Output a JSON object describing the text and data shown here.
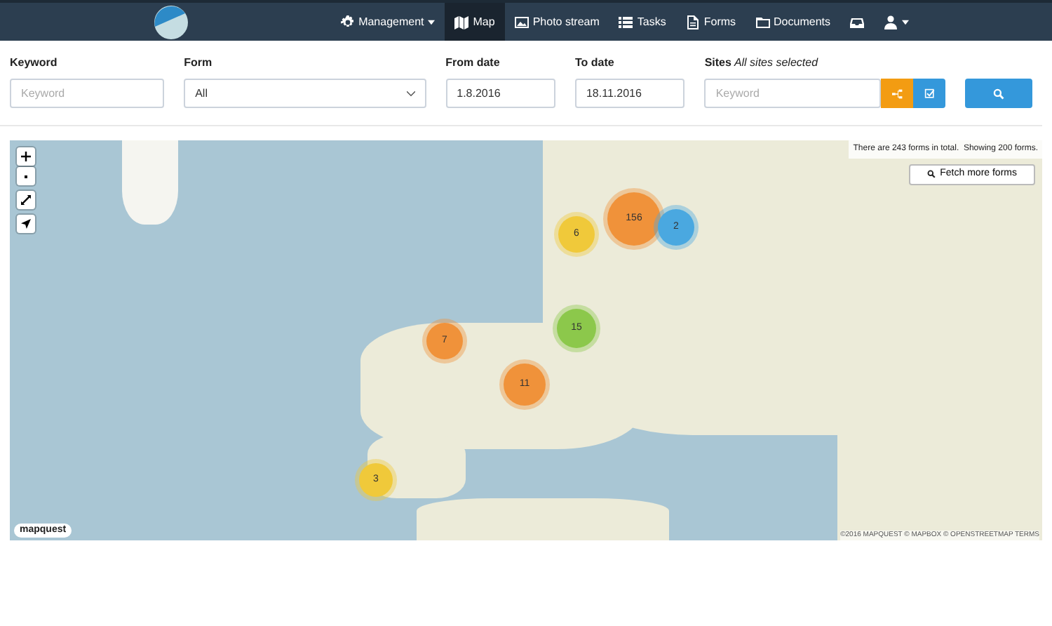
{
  "navbar": {
    "items": [
      {
        "label": "Management",
        "dropdown": true,
        "selected": false
      },
      {
        "label": "Map",
        "dropdown": false,
        "selected": true
      },
      {
        "label": "Photo stream",
        "dropdown": false,
        "selected": false
      },
      {
        "label": "Tasks",
        "dropdown": false,
        "selected": false
      },
      {
        "label": "Forms",
        "dropdown": false,
        "selected": false
      },
      {
        "label": "Documents",
        "dropdown": false,
        "selected": false
      },
      {
        "dropdown": false,
        "selected": false
      },
      {
        "dropdown": true,
        "selected": false
      }
    ]
  },
  "filters": {
    "keyword": {
      "label": "Keyword",
      "placeholder": "Keyword"
    },
    "form": {
      "label": "Form",
      "value": "All"
    },
    "from_date": {
      "label": "From date",
      "value": "1.8.2016"
    },
    "to_date": {
      "label": "To date",
      "value": "18.11.2016"
    },
    "sites": {
      "label": "Sites",
      "note": "All sites selected",
      "placeholder": "Keyword"
    }
  },
  "map": {
    "info": "There are 243 forms in total.  Showing 200 forms.",
    "fetch_button": "Fetch more forms",
    "logo": "mapquest",
    "attribution": "©2016 MAPQUEST © MAPBOX © OPENSTREETMAP TERMS",
    "clusters": [
      {
        "count": "156",
        "color": "#f0923a"
      },
      {
        "count": "2",
        "color": "#4aa8e0"
      },
      {
        "count": "6",
        "color": "#f0c93a"
      },
      {
        "count": "7",
        "color": "#f0923a"
      },
      {
        "count": "15",
        "color": "#8cc84b"
      },
      {
        "count": "11",
        "color": "#f0923a"
      },
      {
        "count": "3",
        "color": "#f0c93a"
      }
    ]
  }
}
